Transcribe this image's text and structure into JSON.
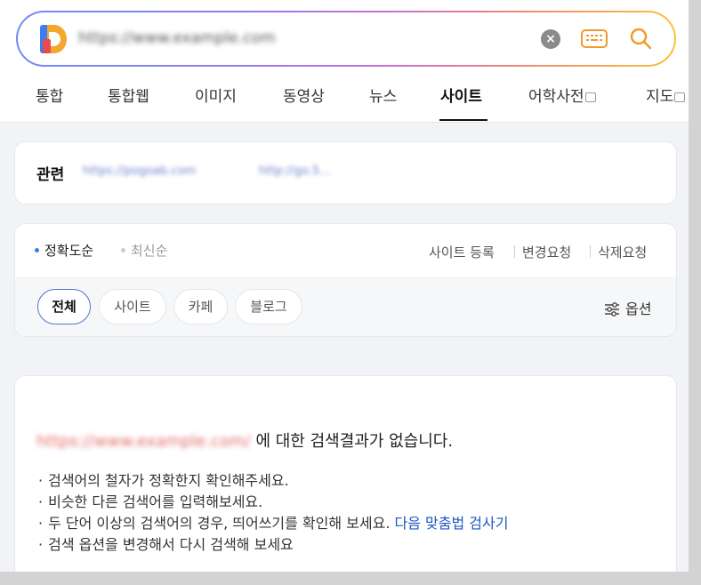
{
  "search": {
    "query": "https://www.example.com",
    "colors": {
      "gradient": [
        "#6f8cf2",
        "#c56fd9",
        "#f7c23a"
      ],
      "accent": "#f29a2e"
    }
  },
  "tabs": [
    {
      "label": "통합",
      "active": false
    },
    {
      "label": "통합웹",
      "active": false
    },
    {
      "label": "이미지",
      "active": false
    },
    {
      "label": "동영상",
      "active": false
    },
    {
      "label": "뉴스",
      "active": false
    },
    {
      "label": "사이트",
      "active": true
    },
    {
      "label": "어학사전",
      "active": false,
      "external": true
    },
    {
      "label": "지도",
      "active": false,
      "external": true
    }
  ],
  "related": {
    "label": "관련",
    "links": [
      "https://pogoab.com",
      "http://go.5..."
    ]
  },
  "sort": {
    "options": [
      {
        "label": "정확도순",
        "active": true
      },
      {
        "label": "최신순",
        "active": false
      }
    ],
    "actions": [
      "사이트 등록",
      "변경요청",
      "삭제요청"
    ]
  },
  "chips": [
    {
      "label": "전체",
      "active": true
    },
    {
      "label": "사이트",
      "active": false
    },
    {
      "label": "카페",
      "active": false
    },
    {
      "label": "블로그",
      "active": false
    }
  ],
  "options_label": "옵션",
  "results": {
    "query": "https://www.example.com/",
    "message": "에 대한 검색결과가 없습니다.",
    "tips": [
      "검색어의 철자가 정확한지 확인해주세요.",
      "비슷한 다른 검색어를 입력해보세요.",
      "두 단어 이상의 검색어의 경우, 띄어쓰기를 확인해 보세요.",
      "검색 옵션을 변경해서 다시 검색해 보세요"
    ],
    "spelling_link": "다음 맞춤법 검사기"
  }
}
